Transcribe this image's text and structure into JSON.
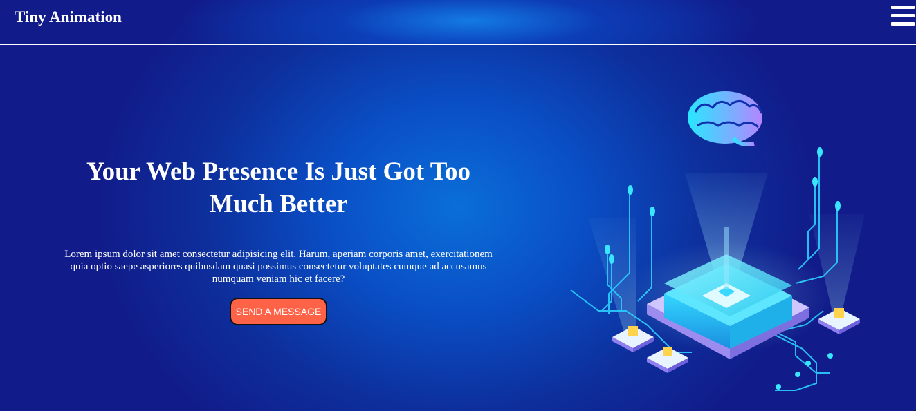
{
  "header": {
    "brand": "Tiny Animation",
    "menu_icon": "hamburger-menu-icon"
  },
  "hero": {
    "title": "Your Web Presence Is Just Got Too Much Better",
    "description": "Lorem ipsum dolor sit amet consectetur adipisicing elit. Harum, aperiam corporis amet, exercitationem quia optio saepe asperiores quibusdam quasi possimus consectetur voluptates cumque ad accusamus numquam veniam hic et facere?",
    "cta_label": "SEND A MESSAGE"
  },
  "illustration": {
    "icon": "ai-chip-brain-illustration",
    "colors": {
      "accent_cyan": "#39e6ff",
      "accent_purple": "#b07cff",
      "cta_orange": "#ff6347"
    }
  }
}
